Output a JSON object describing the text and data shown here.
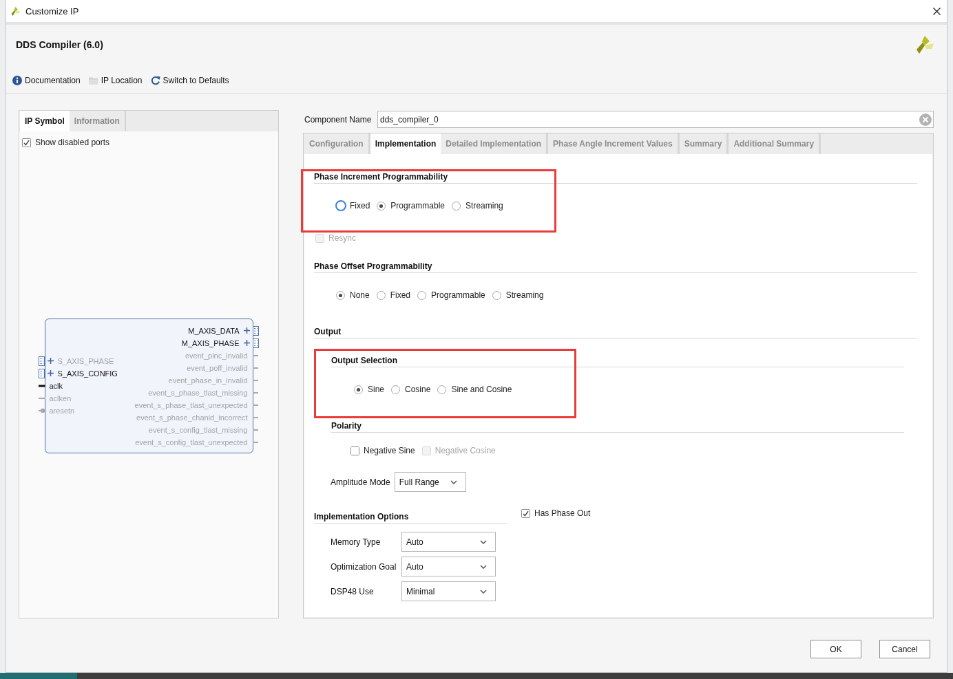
{
  "window": {
    "title": "Customize IP"
  },
  "header": {
    "title": "DDS Compiler (6.0)"
  },
  "toolbar": [
    {
      "kind": "info",
      "label": "Documentation"
    },
    {
      "kind": "folder",
      "label": "IP Location"
    },
    {
      "kind": "refresh",
      "label": "Switch to Defaults"
    }
  ],
  "left_panel": {
    "tabs": [
      {
        "label": "IP Symbol",
        "selected": true
      },
      {
        "label": "Information",
        "selected": false
      }
    ],
    "show_disabled_ports": {
      "label": "Show disabled ports",
      "checked": true
    },
    "symbol": {
      "left_ports": [
        {
          "name": "S_AXIS_PHASE",
          "kind": "bus",
          "disabled": true
        },
        {
          "name": "S_AXIS_CONFIG",
          "kind": "bus",
          "disabled": false
        },
        {
          "name": "aclk",
          "kind": "clock",
          "disabled": false
        },
        {
          "name": "aclken",
          "kind": "signal",
          "disabled": true
        },
        {
          "name": "aresetn",
          "kind": "reset",
          "disabled": true
        }
      ],
      "right_ports": [
        {
          "name": "M_AXIS_DATA",
          "kind": "bus",
          "disabled": false
        },
        {
          "name": "M_AXIS_PHASE",
          "kind": "bus",
          "disabled": false
        },
        {
          "name": "event_pinc_invalid",
          "kind": "signal",
          "disabled": true
        },
        {
          "name": "event_poff_invalid",
          "kind": "signal",
          "disabled": true
        },
        {
          "name": "event_phase_in_invalid",
          "kind": "signal",
          "disabled": true
        },
        {
          "name": "event_s_phase_tlast_missing",
          "kind": "signal",
          "disabled": true
        },
        {
          "name": "event_s_phase_tlast_unexpected",
          "kind": "signal",
          "disabled": true
        },
        {
          "name": "event_s_phase_chanid_incorrect",
          "kind": "signal",
          "disabled": true
        },
        {
          "name": "event_s_config_tlast_missing",
          "kind": "signal",
          "disabled": true
        },
        {
          "name": "event_s_config_tlast_unexpected",
          "kind": "signal",
          "disabled": true
        }
      ]
    }
  },
  "component_name": {
    "label": "Component Name",
    "value": "dds_compiler_0"
  },
  "tabs": [
    {
      "label": "Configuration",
      "selected": false
    },
    {
      "label": "Implementation",
      "selected": true
    },
    {
      "label": "Detailed Implementation",
      "selected": false
    },
    {
      "label": "Phase Angle Increment Values",
      "selected": false
    },
    {
      "label": "Summary",
      "selected": false
    },
    {
      "label": "Additional Summary",
      "selected": false
    }
  ],
  "phase_increment": {
    "title": "Phase Increment Programmability",
    "highlighted": true,
    "options": [
      {
        "label": "Fixed",
        "selected": false,
        "focused": true
      },
      {
        "label": "Programmable",
        "selected": true,
        "focused": false
      },
      {
        "label": "Streaming",
        "selected": false,
        "focused": false
      }
    ],
    "resync": {
      "label": "Resync",
      "checked": false,
      "disabled": true
    }
  },
  "phase_offset": {
    "title": "Phase Offset Programmability",
    "options": [
      {
        "label": "None",
        "selected": true,
        "focused": false
      },
      {
        "label": "Fixed",
        "selected": false,
        "focused": false
      },
      {
        "label": "Programmable",
        "selected": false,
        "focused": false
      },
      {
        "label": "Streaming",
        "selected": false,
        "focused": false
      }
    ]
  },
  "output": {
    "title": "Output",
    "output_selection": {
      "title": "Output Selection",
      "highlighted": true,
      "options": [
        {
          "label": "Sine",
          "selected": true,
          "focused": false
        },
        {
          "label": "Cosine",
          "selected": false,
          "focused": false
        },
        {
          "label": "Sine and Cosine",
          "selected": false,
          "focused": false
        }
      ]
    },
    "polarity": {
      "title": "Polarity",
      "options": [
        {
          "label": "Negative Sine",
          "checked": false,
          "disabled": false
        },
        {
          "label": "Negative Cosine",
          "checked": false,
          "disabled": true
        }
      ]
    },
    "amplitude_mode": {
      "label": "Amplitude Mode",
      "value": "Full Range"
    }
  },
  "implementation_options": {
    "title": "Implementation Options",
    "fields": [
      {
        "label": "Memory Type",
        "value": "Auto"
      },
      {
        "label": "Optimization Goal",
        "value": "Auto"
      },
      {
        "label": "DSP48 Use",
        "value": "Minimal"
      }
    ]
  },
  "has_phase_out": {
    "label": "Has Phase Out",
    "checked": true
  },
  "buttons": [
    {
      "label": "OK"
    },
    {
      "label": "Cancel"
    }
  ]
}
